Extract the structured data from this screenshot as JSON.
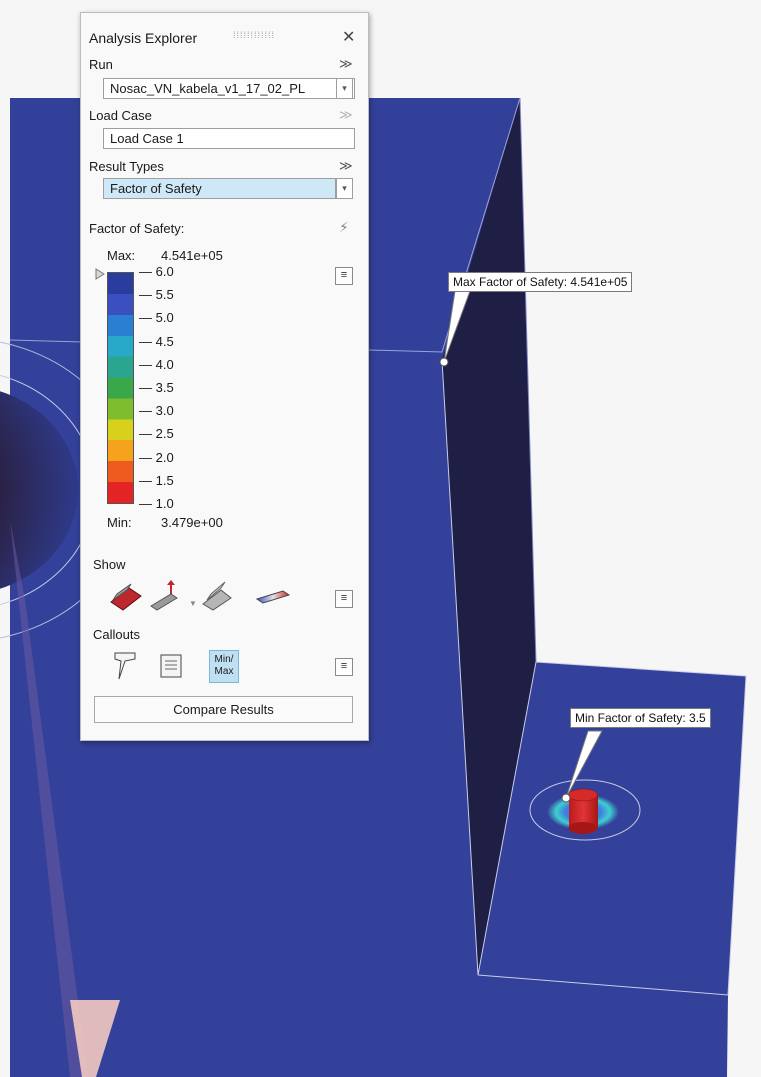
{
  "panel": {
    "title": "Analysis Explorer",
    "run": {
      "label": "Run",
      "value": "Nosac_VN_kabela_v1_17_02_PL"
    },
    "load_case": {
      "label": "Load Case",
      "value": "Load Case 1"
    },
    "result_types": {
      "label": "Result Types",
      "value": "Factor of Safety"
    },
    "legend": {
      "title": "Factor of Safety:",
      "max_label": "Max:",
      "max_value": "4.541e+05",
      "min_label": "Min:",
      "min_value": "3.479e+00",
      "ticks": [
        "6.0",
        "5.5",
        "5.0",
        "4.5",
        "4.0",
        "3.5",
        "3.0",
        "2.5",
        "2.0",
        "1.5",
        "1.0"
      ]
    },
    "show_label": "Show",
    "callouts_label": "Callouts",
    "minmax_line1": "Min/",
    "minmax_line2": "Max",
    "compare_button": "Compare Results"
  },
  "callouts": {
    "max": "Max Factor of Safety: 4.541e+05",
    "min": "Min Factor of Safety: 3.5"
  },
  "colors": {
    "model_blue": "#34419a",
    "wall_dark": "#1f1f45",
    "selected_field": "#cfe8f7"
  },
  "icons": {
    "close": "close-icon",
    "run_chevron": "double-chevron-down-icon",
    "bolt": "lightning-icon",
    "legend_menu": "hamburger-menu-icon",
    "show_deformed": "deformed-shape-icon",
    "show_loads": "loads-icon",
    "show_undeformed": "undeformed-shape-icon",
    "show_contour": "contour-icon",
    "callout_pointer": "callout-pointer-icon",
    "callout_note": "note-callout-icon"
  }
}
